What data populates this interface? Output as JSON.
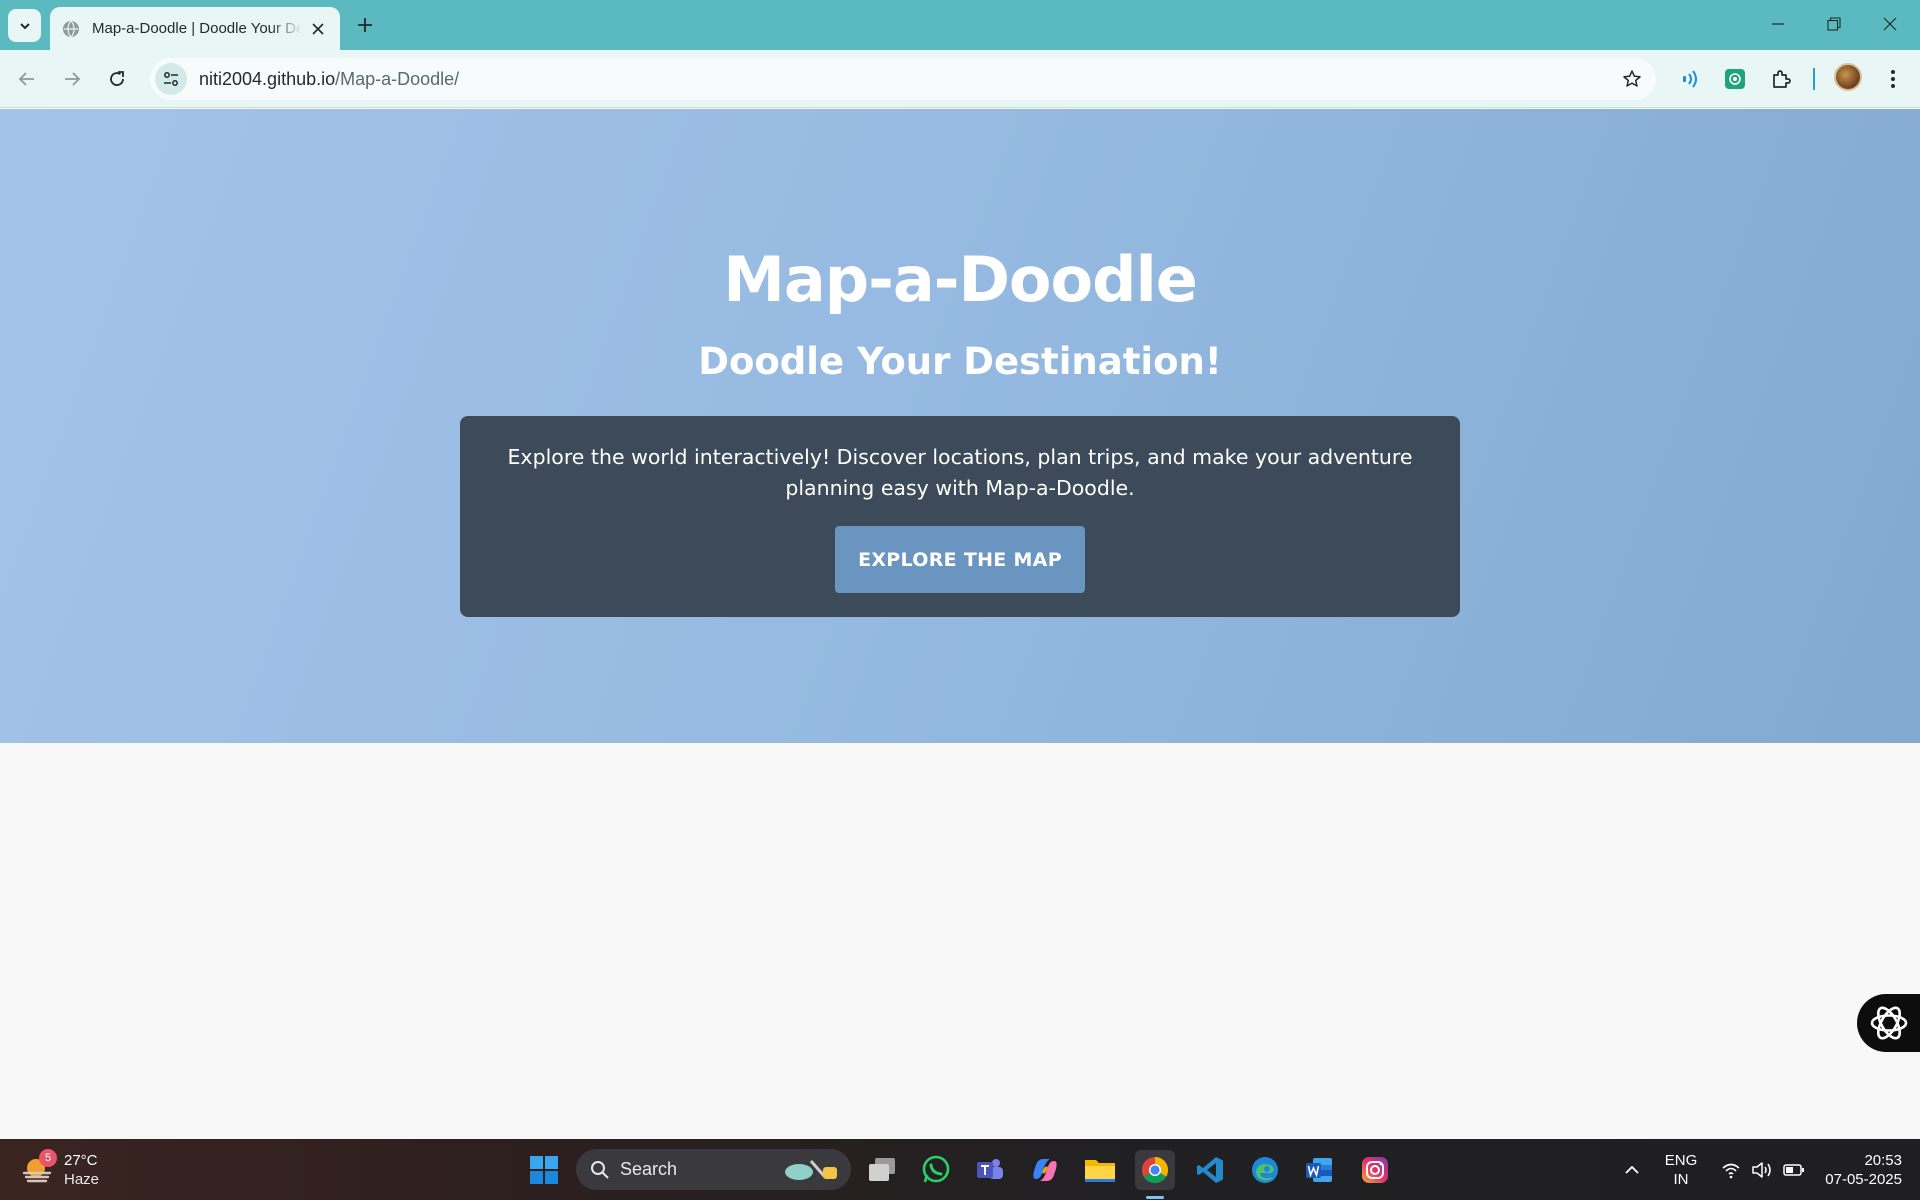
{
  "browser": {
    "tab": {
      "title": "Map-a-Doodle | Doodle Your Destination!"
    },
    "url": {
      "host": "niti2004.github.io",
      "path": "/Map-a-Doodle/"
    }
  },
  "page": {
    "title": "Map-a-Doodle",
    "subtitle": "Doodle Your Destination!",
    "description": "Explore the world interactively! Discover locations, plan trips, and make your adventure planning easy with Map-a-Doodle.",
    "cta_label": "EXPLORE THE MAP"
  },
  "taskbar": {
    "weather": {
      "badge": "5",
      "temp": "27°C",
      "condition": "Haze"
    },
    "search_label": "Search",
    "lang": {
      "line1": "ENG",
      "line2": "IN"
    },
    "clock": {
      "time": "20:53",
      "date": "07-05-2025"
    }
  },
  "colors": {
    "tab_strip": "#5bbac0",
    "hero_start": "#a4c3ea",
    "hero_end": "#82a9d0",
    "card_bg": "#3c4a5a",
    "cta_bg": "#6a95c1"
  },
  "icons": [
    "chevron-down-icon",
    "globe-icon",
    "close-icon",
    "plus-icon",
    "minimize-icon",
    "restore-icon",
    "back-icon",
    "forward-icon",
    "reload-icon",
    "site-info-icon",
    "star-icon",
    "read-aloud-icon",
    "chatgpt-extension-icon",
    "extensions-icon",
    "menu-icon",
    "windows-start-icon",
    "search-icon",
    "task-view-icon",
    "whatsapp-icon",
    "teams-icon",
    "copilot-icon",
    "file-explorer-icon",
    "chrome-icon",
    "vscode-icon",
    "edge-icon",
    "word-icon",
    "instagram-icon",
    "chevron-up-icon",
    "wifi-icon",
    "volume-icon",
    "battery-icon"
  ]
}
